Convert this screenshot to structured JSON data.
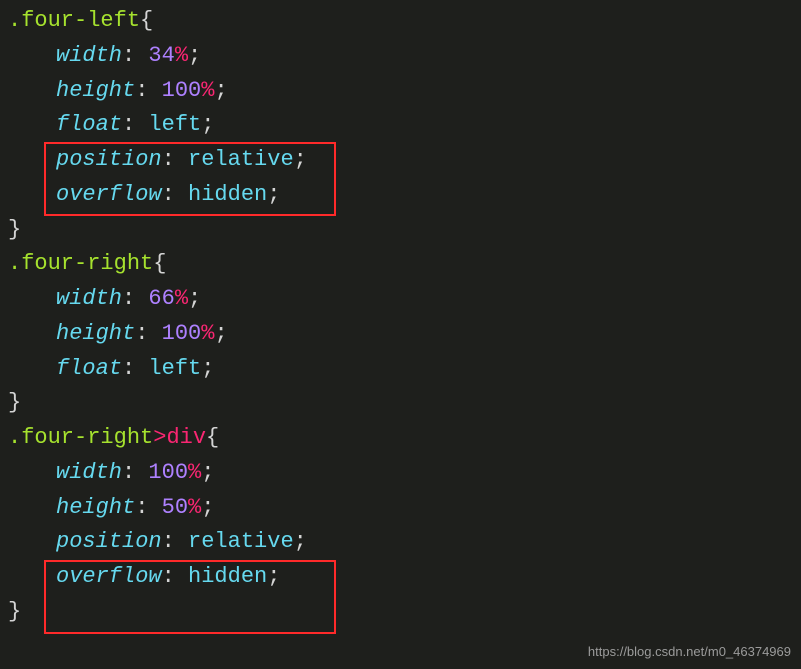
{
  "blocks": [
    {
      "selector": {
        "class": ".four-left"
      },
      "decls": [
        {
          "prop": "width",
          "value": "34",
          "unit": "%"
        },
        {
          "prop": "height",
          "value": "100",
          "unit": "%"
        },
        {
          "prop": "float",
          "value": "left",
          "unit": ""
        },
        {
          "prop": "position",
          "value": "relative",
          "unit": ""
        },
        {
          "prop": "overflow",
          "value": "hidden",
          "unit": ""
        }
      ]
    },
    {
      "selector": {
        "class": ".four-right"
      },
      "decls": [
        {
          "prop": "width",
          "value": "66",
          "unit": "%"
        },
        {
          "prop": "height",
          "value": "100",
          "unit": "%"
        },
        {
          "prop": "float",
          "value": "left",
          "unit": ""
        }
      ]
    },
    {
      "selector": {
        "class": ".four-right",
        "combinator": ">",
        "tag": "div"
      },
      "decls": [
        {
          "prop": "width",
          "value": "100",
          "unit": "%"
        },
        {
          "prop": "height",
          "value": "50",
          "unit": "%"
        },
        {
          "prop": "position",
          "value": "relative",
          "unit": ""
        },
        {
          "prop": "overflow",
          "value": "hidden",
          "unit": ""
        }
      ]
    }
  ],
  "brace_open": "{",
  "brace_close": "}",
  "colon": ":",
  "semi": ";",
  "watermark": "https://blog.csdn.net/m0_46374969"
}
